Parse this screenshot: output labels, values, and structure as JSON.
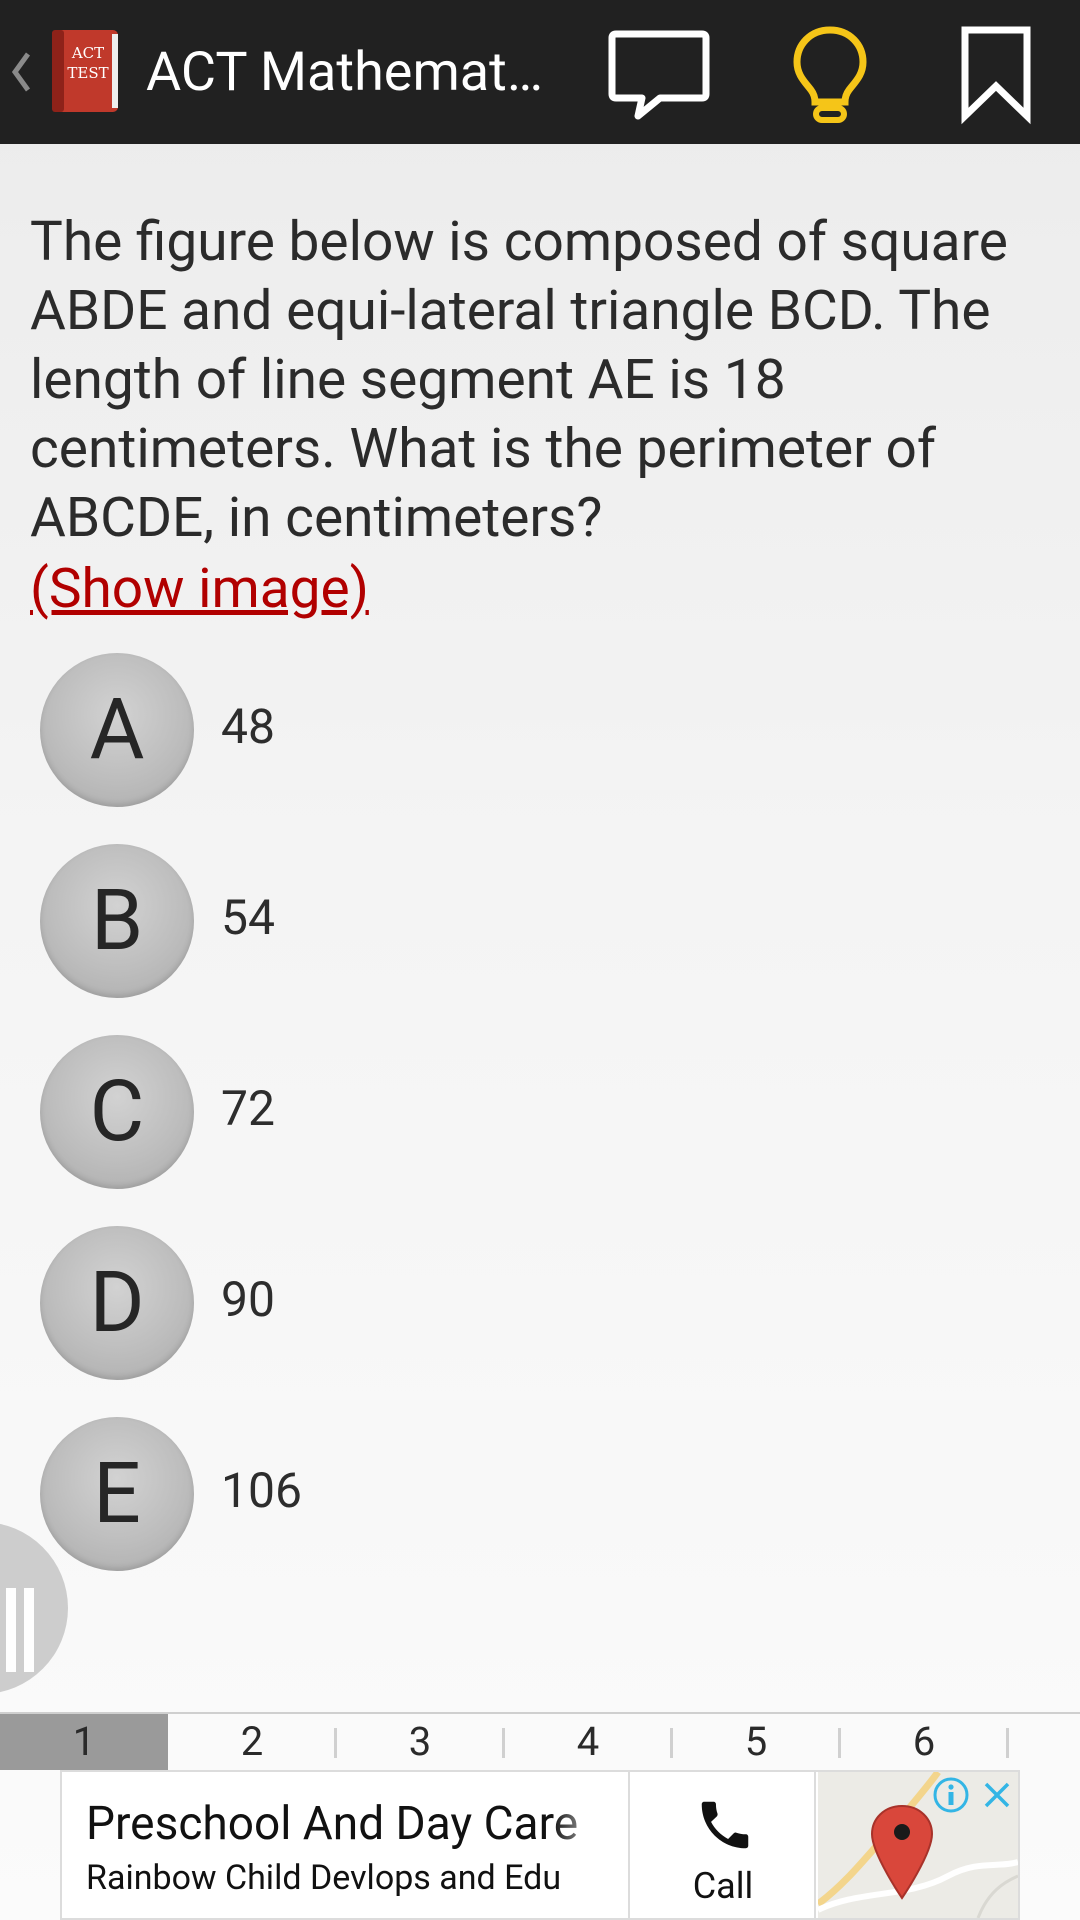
{
  "action_bar": {
    "title": "ACT Mathemat…",
    "app_icon_text": "ACT TEST",
    "icons": [
      "chevron-left-icon",
      "app-icon",
      "comment-icon",
      "lightbulb-icon",
      "bookmark-icon"
    ],
    "colors": {
      "bar": "#212121",
      "hint": "#f5c518",
      "icons": "#ffffff"
    }
  },
  "question": {
    "text": "The figure below is composed of square ABDE and equi-lateral triangle BCD. The length of line segment AE is 18 centimeters. What is the perimeter of ABCDE, in centimeters?",
    "show_image_label": "(Show image)"
  },
  "options": [
    {
      "letter": "A",
      "value": "48"
    },
    {
      "letter": "B",
      "value": "54"
    },
    {
      "letter": "C",
      "value": "72"
    },
    {
      "letter": "D",
      "value": "90"
    },
    {
      "letter": "E",
      "value": "106"
    }
  ],
  "page_tabs": {
    "items": [
      "1",
      "2",
      "3",
      "4",
      "5",
      "6"
    ],
    "active": "1"
  },
  "ad": {
    "title": "Preschool And Day Care",
    "subtitle": "Rainbow Child Devlops and Edu",
    "call_label": "Call",
    "colors": {
      "link": "#b10000",
      "info": "#33b5e5"
    }
  }
}
